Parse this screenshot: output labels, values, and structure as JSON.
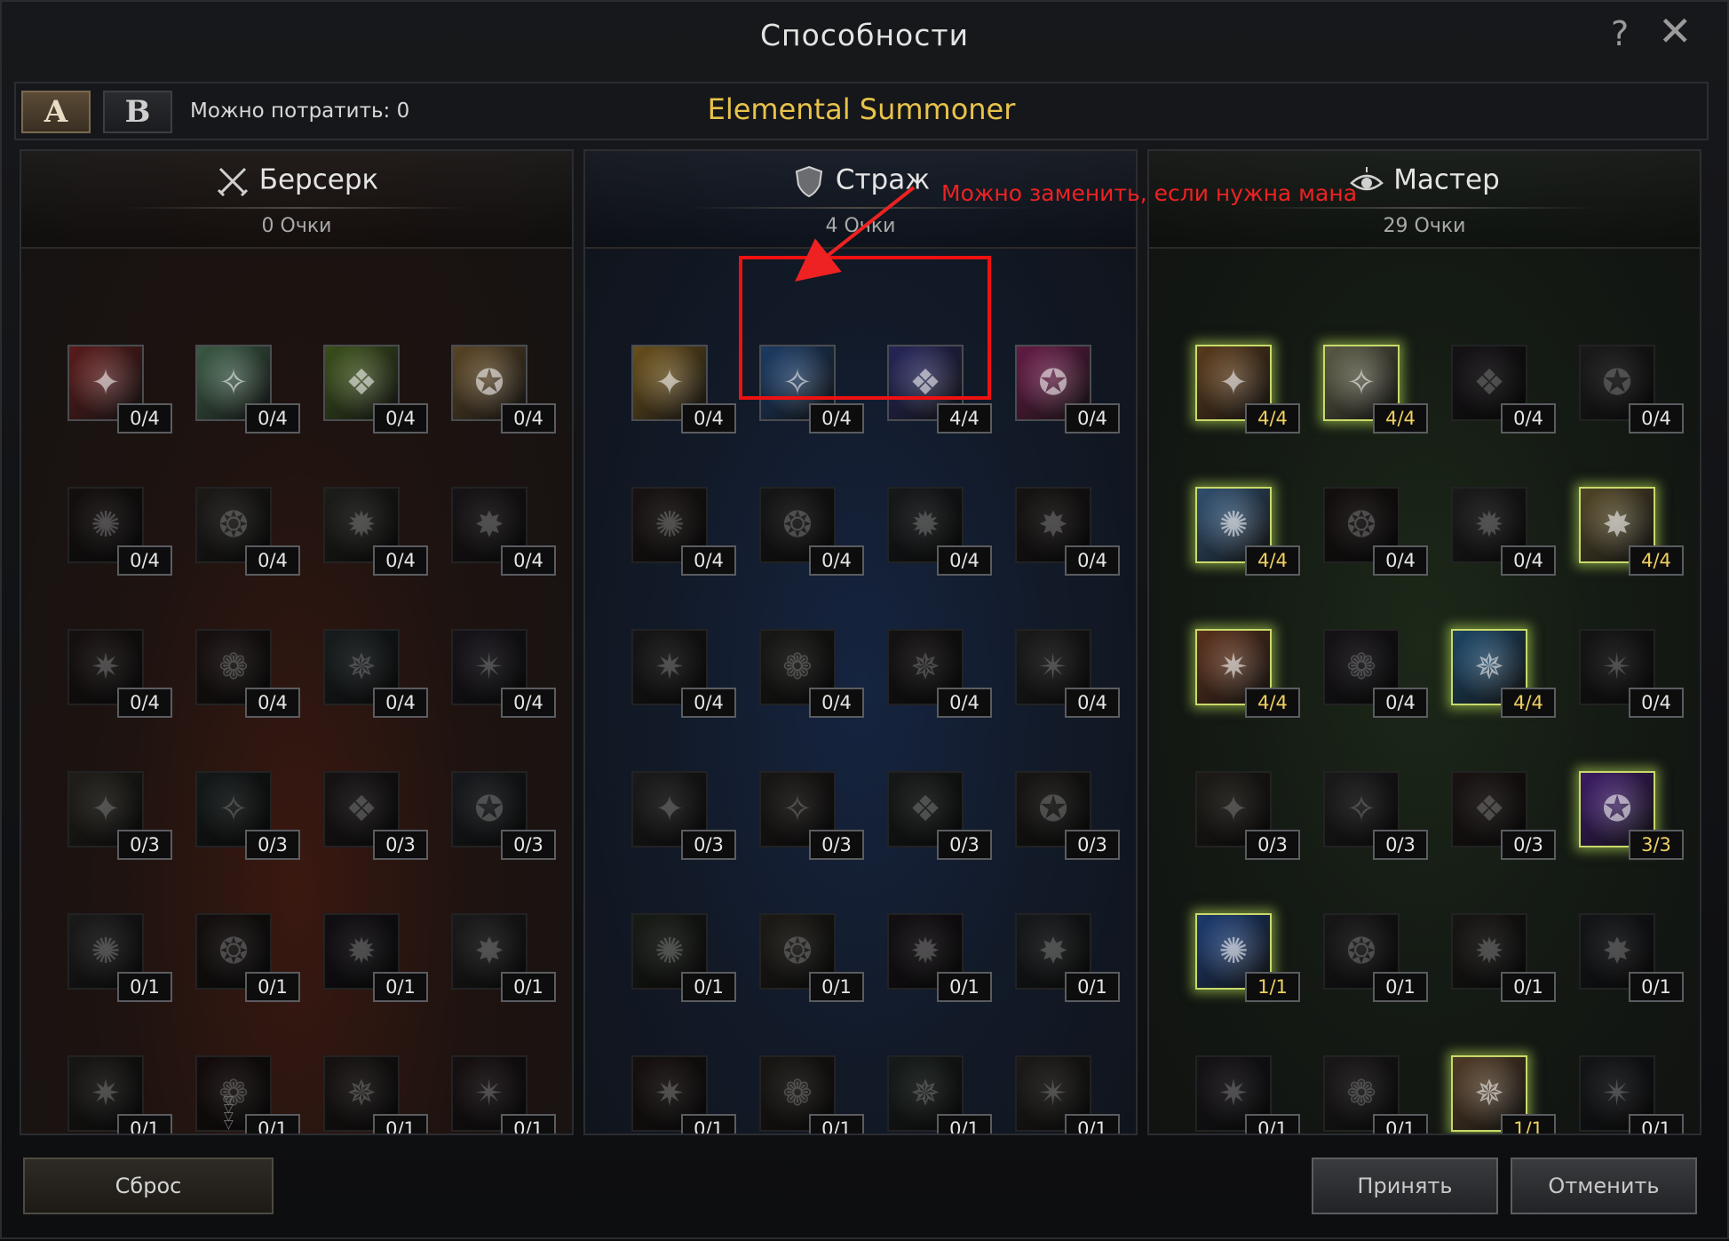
{
  "window": {
    "title": "Способности",
    "help_label": "?",
    "close_label": "✕"
  },
  "topbar": {
    "presets": [
      "A",
      "B"
    ],
    "points_label": "Можно потратить:",
    "points_value": "0",
    "class_name": "Elemental Summoner"
  },
  "panels": [
    {
      "name": "Берсерк",
      "points": "0 Очки",
      "icon": "crossed-swords-icon",
      "theme": "#7a2a1a",
      "skills": [
        {
          "value": "0/4",
          "icon": "bloody-shield-icon",
          "color": "#8a2a2a",
          "dim": false
        },
        {
          "value": "0/4",
          "icon": "piercing-spear-icon",
          "color": "#5a8a6a",
          "dim": false
        },
        {
          "value": "0/4",
          "icon": "nature-hammer-icon",
          "color": "#5a7a2a",
          "dim": false
        },
        {
          "value": "0/4",
          "icon": "fist-icon",
          "color": "#8a6a3a",
          "dim": false
        },
        {
          "value": "0/4",
          "icon": "roaring-beast-icon",
          "color": "#6a2a2a",
          "dim": true
        },
        {
          "value": "0/4",
          "icon": "scroll-icon",
          "color": "#6a5a3a",
          "dim": true
        },
        {
          "value": "0/4",
          "icon": "sword-icon",
          "color": "#5a6a3a",
          "dim": true
        },
        {
          "value": "0/4",
          "icon": "skull-icon",
          "color": "#6a3a5a",
          "dim": true
        },
        {
          "value": "0/4",
          "icon": "blade-strike-icon",
          "color": "#7a2a2a",
          "dim": true
        },
        {
          "value": "0/4",
          "icon": "rune-icon",
          "color": "#8a2a2a",
          "dim": true
        },
        {
          "value": "0/4",
          "icon": "ice-blade-icon",
          "color": "#2a6a7a",
          "dim": true
        },
        {
          "value": "0/4",
          "icon": "twisted-staff-icon",
          "color": "#5a3a7a",
          "dim": true
        },
        {
          "value": "0/3",
          "icon": "gauntlet-icon",
          "color": "#7a6a2a",
          "dim": true
        },
        {
          "value": "0/3",
          "icon": "crystal-blade-icon",
          "color": "#2a5a5a",
          "dim": true
        },
        {
          "value": "0/3",
          "icon": "slash-icon",
          "color": "#6a3a4a",
          "dim": true
        },
        {
          "value": "0/3",
          "icon": "magic-wand-icon",
          "color": "#3a5a7a",
          "dim": true
        },
        {
          "value": "0/1",
          "icon": "anvil-icon",
          "color": "#5a5a5a",
          "dim": true
        },
        {
          "value": "0/1",
          "icon": "claw-icon",
          "color": "#6a2a2a",
          "dim": true
        },
        {
          "value": "0/1",
          "icon": "dark-wing-icon",
          "color": "#4a2a5a",
          "dim": true
        },
        {
          "value": "0/1",
          "icon": "figures-icon",
          "color": "#5a5a6a",
          "dim": true
        },
        {
          "value": "0/1",
          "icon": "hourglass-icon",
          "color": "#5a4a3a",
          "dim": true
        },
        {
          "value": "0/1",
          "icon": "blood-roses-icon",
          "color": "#7a1a1a",
          "dim": true
        },
        {
          "value": "0/1",
          "icon": "horned-demon-icon",
          "color": "#6a3a2a",
          "dim": true
        },
        {
          "value": "0/1",
          "icon": "red-orb-icon",
          "color": "#7a2a3a",
          "dim": true
        }
      ]
    },
    {
      "name": "Страж",
      "points": "4 Очки",
      "icon": "shield-icon",
      "theme": "#1a3a6a",
      "skills": [
        {
          "value": "0/4",
          "icon": "golden-bell-icon",
          "color": "#a07a2a",
          "dim": false
        },
        {
          "value": "0/4",
          "icon": "spirit-hand-icon",
          "color": "#2a5a9a",
          "dim": false
        },
        {
          "value": "4/4",
          "icon": "shadow-flame-icon",
          "color": "#3a3a8a",
          "dim": false
        },
        {
          "value": "0/4",
          "icon": "cyan-spirit-icon",
          "color": "#9a2a6a",
          "dim": false
        },
        {
          "value": "0/4",
          "icon": "fire-dragon-icon",
          "color": "#7a3a2a",
          "dim": true
        },
        {
          "value": "0/4",
          "icon": "cross-wheel-icon",
          "color": "#4a4a4a",
          "dim": true
        },
        {
          "value": "0/4",
          "icon": "clover-shield-icon",
          "color": "#3a5a6a",
          "dim": true
        },
        {
          "value": "0/4",
          "icon": "holy-cross-icon",
          "color": "#6a3a3a",
          "dim": true
        },
        {
          "value": "0/4",
          "icon": "sparkle-lance-icon",
          "color": "#4a4a5a",
          "dim": true
        },
        {
          "value": "0/4",
          "icon": "time-hourglass-icon",
          "color": "#4a5a3a",
          "dim": true
        },
        {
          "value": "0/4",
          "icon": "broken-heart-icon",
          "color": "#5a3a3a",
          "dim": true
        },
        {
          "value": "0/4",
          "icon": "pale-mask-icon",
          "color": "#5a5a5a",
          "dim": true
        },
        {
          "value": "0/3",
          "icon": "gear-cross-icon",
          "color": "#5a5a5a",
          "dim": true
        },
        {
          "value": "0/3",
          "icon": "angel-wing-icon",
          "color": "#6a4a3a",
          "dim": true
        },
        {
          "value": "0/3",
          "icon": "crystal-drop-icon",
          "color": "#3a5a5a",
          "dim": true
        },
        {
          "value": "0/3",
          "icon": "winged-boot-icon",
          "color": "#5a4a3a",
          "dim": true
        },
        {
          "value": "0/1",
          "icon": "green-tree-icon",
          "color": "#3a6a2a",
          "dim": true
        },
        {
          "value": "0/1",
          "icon": "all-seeing-eye-icon",
          "color": "#6a5a2a",
          "dim": true
        },
        {
          "value": "0/1",
          "icon": "dragon-scale-icon",
          "color": "#5a2a5a",
          "dim": true
        },
        {
          "value": "0/1",
          "icon": "crossed-blades-icon",
          "color": "#3a5a6a",
          "dim": true
        },
        {
          "value": "0/1",
          "icon": "red-beast-icon",
          "color": "#7a2a2a",
          "dim": true
        },
        {
          "value": "0/1",
          "icon": "armor-icon",
          "color": "#6a4a2a",
          "dim": true
        },
        {
          "value": "0/1",
          "icon": "meditation-icon",
          "color": "#2a6a5a",
          "dim": true
        },
        {
          "value": "0/1",
          "icon": "cross-mace-icon",
          "color": "#6a5a3a",
          "dim": true
        }
      ]
    },
    {
      "name": "Мастер",
      "points": "29 Очки",
      "icon": "eye-icon",
      "theme": "#2a4a1a",
      "skills": [
        {
          "value": "4/4",
          "icon": "war-hammer-icon",
          "color": "#8a5a2a",
          "dim": false,
          "active": true
        },
        {
          "value": "4/4",
          "icon": "pale-face-icon",
          "color": "#8a8a6a",
          "dim": false,
          "active": true
        },
        {
          "value": "0/4",
          "icon": "vine-emblem-icon",
          "color": "#5a3a5a",
          "dim": true
        },
        {
          "value": "0/4",
          "icon": "knight-helmet-icon",
          "color": "#5a5a5a",
          "dim": true
        },
        {
          "value": "4/4",
          "icon": "golden-key-icon",
          "color": "#4a7aaa",
          "dim": false,
          "active": true
        },
        {
          "value": "0/4",
          "icon": "dark-raven-icon",
          "color": "#6a2a2a",
          "dim": true
        },
        {
          "value": "0/4",
          "icon": "hammer-icon",
          "color": "#5a5a5a",
          "dim": true
        },
        {
          "value": "4/4",
          "icon": "spellbook-icon",
          "color": "#7a6a3a",
          "dim": false,
          "active": true
        },
        {
          "value": "4/4",
          "icon": "cross-shield-icon",
          "color": "#8a4a2a",
          "dim": false,
          "active": true
        },
        {
          "value": "0/4",
          "icon": "purple-scale-icon",
          "color": "#5a3a6a",
          "dim": true
        },
        {
          "value": "4/4",
          "icon": "serpent-staff-icon",
          "color": "#2a6a9a",
          "dim": false,
          "active": true
        },
        {
          "value": "0/4",
          "icon": "four-leaf-icon",
          "color": "#3a4a3a",
          "dim": true
        },
        {
          "value": "0/3",
          "icon": "bird-totem-icon",
          "color": "#7a5a2a",
          "dim": true
        },
        {
          "value": "0/3",
          "icon": "arc-blade-icon",
          "color": "#5a5a5a",
          "dim": true
        },
        {
          "value": "0/3",
          "icon": "double-cross-icon",
          "color": "#7a3a2a",
          "dim": true
        },
        {
          "value": "3/3",
          "icon": "void-rift-icon",
          "color": "#5a2a9a",
          "dim": false,
          "active": true
        },
        {
          "value": "1/1",
          "icon": "ice-crown-icon",
          "color": "#2a5aaa",
          "dim": false,
          "active": true
        },
        {
          "value": "0/1",
          "icon": "frost-fist-icon",
          "color": "#5a4a5a",
          "dim": true
        },
        {
          "value": "0/1",
          "icon": "spiked-mace-icon",
          "color": "#5a4a3a",
          "dim": true
        },
        {
          "value": "0/1",
          "icon": "shark-icon",
          "color": "#3a4a6a",
          "dim": true
        },
        {
          "value": "0/1",
          "icon": "purple-wing-icon",
          "color": "#5a3a6a",
          "dim": true
        },
        {
          "value": "0/1",
          "icon": "unicorn-icon",
          "color": "#6a4a5a",
          "dim": true
        },
        {
          "value": "1/1",
          "icon": "bronze-bell-icon",
          "color": "#7a5a3a",
          "dim": false,
          "active": true
        },
        {
          "value": "0/1",
          "icon": "prayer-hands-icon",
          "color": "#3a4a6a",
          "dim": true
        }
      ]
    }
  ],
  "annotation": {
    "text": "Можно заменить, если нужна мана",
    "color": "#ee2222"
  },
  "buttons": {
    "reset": "Сброс",
    "accept": "Принять",
    "cancel": "Отменить"
  }
}
